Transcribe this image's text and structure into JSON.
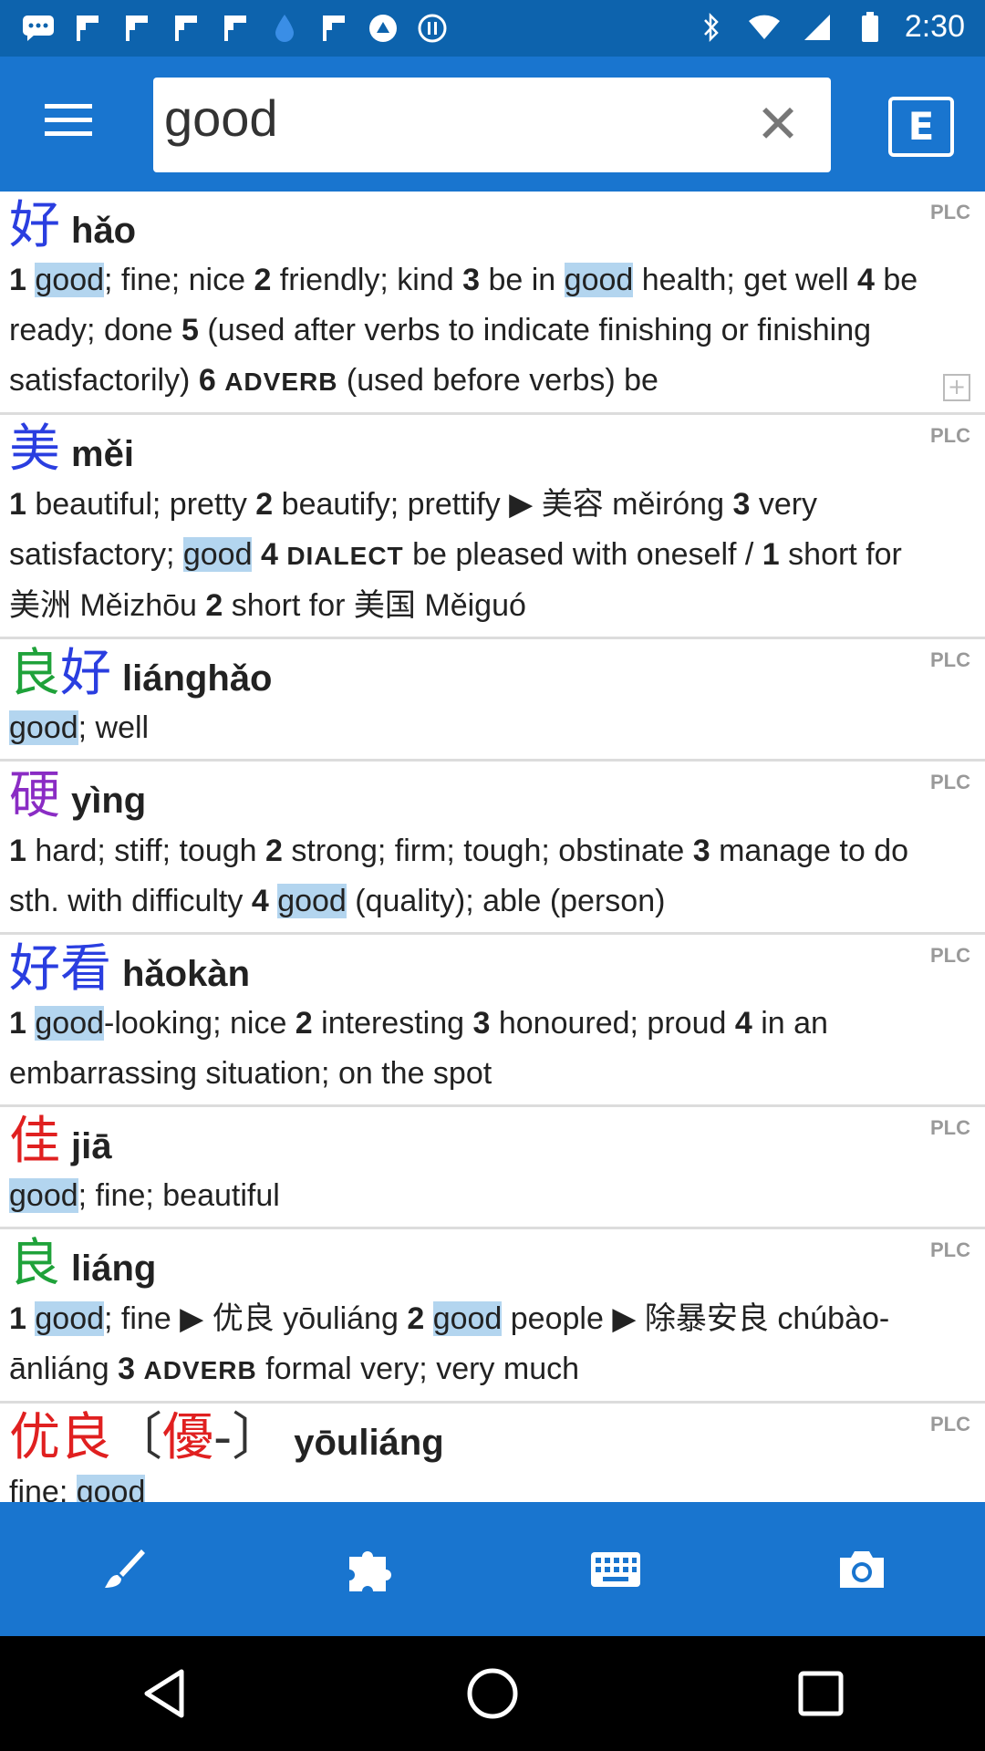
{
  "status_bar": {
    "time": "2:30",
    "left_icons": [
      "messages-icon",
      "flipboard-icon",
      "flipboard-icon",
      "flipboard-icon",
      "flipboard-icon",
      "water-drop-icon",
      "flipboard-icon",
      "app-icon",
      "app-icon"
    ]
  },
  "toolbar": {
    "search_value": "good",
    "e_label": "E"
  },
  "entries": [
    {
      "hanzi": [
        {
          "t": "好",
          "c": "#2a3ee0"
        }
      ],
      "pinyin": "hǎo",
      "plc": "PLC",
      "definition": "1 good; fine; nice  2 friendly; kind  3 be in good health; get well  4 be ready; done  5 (used after verbs to indicate finishing or finishing satisfactorily)  6 ADVERB (used before verbs) be",
      "expandable": true
    },
    {
      "hanzi": [
        {
          "t": "美",
          "c": "#2a3ee0"
        }
      ],
      "pinyin": "měi",
      "plc": "PLC",
      "definition": "1 beautiful; pretty  2 beautify; prettify ▶ 美容 měiróng  3 very satisfactory; good  4 DIALECT be pleased with oneself  /  1 short for 美洲 Měizhōu  2 short for 美国 Měiguó"
    },
    {
      "hanzi": [
        {
          "t": "良",
          "c": "#1fa23a"
        },
        {
          "t": "好",
          "c": "#2a3ee0"
        }
      ],
      "pinyin": "liánghǎo",
      "plc": "PLC",
      "definition": "good; well"
    },
    {
      "hanzi": [
        {
          "t": "硬",
          "c": "#8a2cc4"
        }
      ],
      "pinyin": "yìng",
      "plc": "PLC",
      "definition": "1 hard; stiff; tough  2 strong; firm; tough; obstinate  3 manage to do sth. with difficulty  4 good (quality); able (person)"
    },
    {
      "hanzi": [
        {
          "t": "好",
          "c": "#2a3ee0"
        },
        {
          "t": "看",
          "c": "#2a3ee0"
        }
      ],
      "pinyin": "hǎokàn",
      "plc": "PLC",
      "definition": "1 good-looking; nice  2 interesting  3 honoured; proud  4 in an embarrassing situation; on the spot"
    },
    {
      "hanzi": [
        {
          "t": "佳",
          "c": "#e02020"
        }
      ],
      "pinyin": "jiā",
      "plc": "PLC",
      "definition": "good; fine; beautiful"
    },
    {
      "hanzi": [
        {
          "t": "良",
          "c": "#1fa23a"
        }
      ],
      "pinyin": "liáng",
      "plc": "PLC",
      "definition": "1 good; fine ▶ 优良 yōuliáng  2 good people ▶ 除暴安良 chúbào-ānliáng  3 ADVERB formal very; very much"
    },
    {
      "hanzi": [
        {
          "t": "优",
          "c": "#e02020"
        },
        {
          "t": "良",
          "c": "#e02020"
        },
        {
          "t": "〔",
          "c": "#333333"
        },
        {
          "t": "優",
          "c": "#e02020"
        },
        {
          "t": "-〕",
          "c": "#333333"
        }
      ],
      "pinyin": "yōuliáng",
      "plc": "PLC",
      "definition": "fine; good"
    }
  ],
  "highlight_term": "good",
  "bottom_bar": [
    "brush-icon",
    "puzzle-icon",
    "keyboard-icon",
    "camera-icon"
  ],
  "colors": {
    "accent": "#1975cf",
    "status": "#0d63ad",
    "highlight": "#b3d5ef"
  }
}
